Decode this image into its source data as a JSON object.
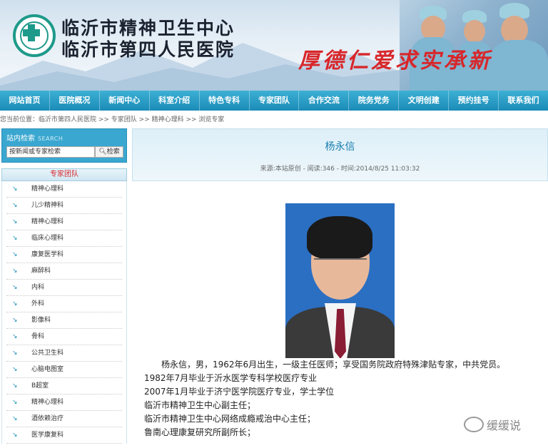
{
  "banner": {
    "name_line1": "临沂市精神卫生中心",
    "name_line2": "临沂市第四人民医院",
    "motto": "厚德仁爱求实承新"
  },
  "nav": {
    "items": [
      "网站首页",
      "医院概况",
      "新闻中心",
      "科室介绍",
      "特色专科",
      "专家团队",
      "合作交流",
      "院务党务",
      "文明创建",
      "预约挂号",
      "联系我们"
    ]
  },
  "breadcrumb": "您当前位置：临沂市第四人民医院 >> 专家团队 >> 精神心理科 >> 浏览专家",
  "sidebar": {
    "search_title": "站内检索",
    "search_title_en": "SEARCH",
    "search_value": "按新闻或专家检索",
    "search_button": "检索",
    "category_header": "专家团队",
    "categories": [
      "精神心理科",
      "儿少精神科",
      "精神心理科",
      "临床心理科",
      "康复医学科",
      "麻醉科",
      "内科",
      "外科",
      "影像科",
      "骨科",
      "公共卫生科",
      "心脑电图室",
      "B超室",
      "精神心理科",
      "酒依赖治疗",
      "医学康复科"
    ]
  },
  "article": {
    "title": "杨永信",
    "meta": "来源:本站原创 - 阅读:346 - 时间:2014/8/25 11:03:32",
    "bio_lines": [
      "杨永信，男，1962年6月出生，一级主任医师；享受国务院政府特殊津贴专家，中共党员。",
      "1982年7月毕业于沂水医学专科学校医疗专业",
      "2007年1月毕业于济宁医学院医疗专业，学士学位",
      "临沂市精神卫生中心副主任；",
      "临沂市精神卫生中心网络成瘾戒治中心主任；",
      "鲁南心理康复研究所副所长；"
    ]
  },
  "watermark": "缓缓说"
}
